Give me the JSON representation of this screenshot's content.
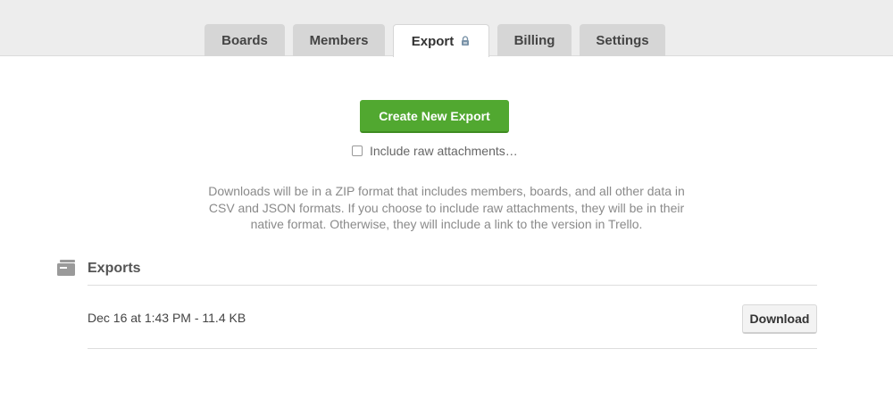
{
  "tabs": [
    {
      "label": "Boards"
    },
    {
      "label": "Members"
    },
    {
      "label": "Export",
      "icon": "lock-icon",
      "active": true
    },
    {
      "label": "Billing"
    },
    {
      "label": "Settings"
    }
  ],
  "export": {
    "create_button": "Create New Export",
    "raw_attachments_label": "Include raw attachments…",
    "raw_attachments_checked": false,
    "description_lines": [
      "Downloads will be in a ZIP format that includes members, boards, and all other data in",
      "CSV and JSON formats. If you choose to include raw attachments, they will be in their",
      "native format. Otherwise, they will include a link to the version in Trello."
    ]
  },
  "exports_section": {
    "title": "Exports",
    "icon": "archive-icon",
    "items": [
      {
        "label": "Dec 16 at 1:43 PM - 11.4 KB",
        "action": "Download"
      }
    ]
  },
  "colors": {
    "accent_green": "#51a830",
    "tab_bg": "#d6d6d6",
    "header_bg": "#ededed"
  }
}
